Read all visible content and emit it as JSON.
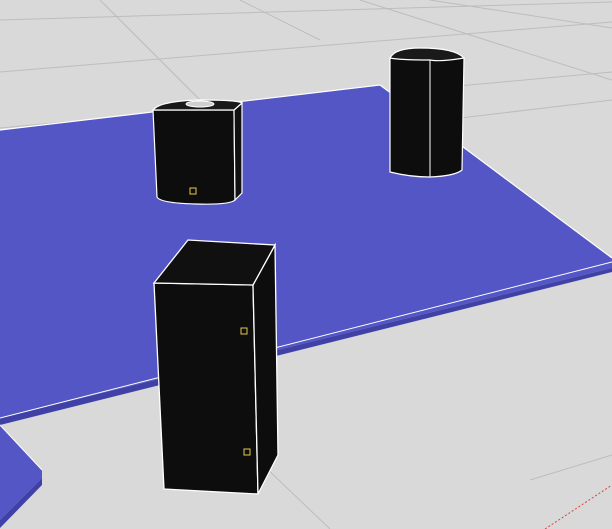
{
  "viewport": {
    "background": "#d9d9d9",
    "grid_color": "#bdbdbd"
  },
  "scene": {
    "platform_color": "#5456c6",
    "platform_edge_color": "#3f41a6",
    "object_fill": "#0d0d0d",
    "object_outline": "#ffffff",
    "marker_color": "#e8c84a",
    "axis_color": "#e04040",
    "objects": [
      {
        "name": "box-small-rounded",
        "shape": "rounded-box",
        "markers": 1
      },
      {
        "name": "cylinder-tall",
        "shape": "cylinder",
        "markers": 0
      },
      {
        "name": "box-tall",
        "shape": "box",
        "markers": 2
      }
    ]
  }
}
